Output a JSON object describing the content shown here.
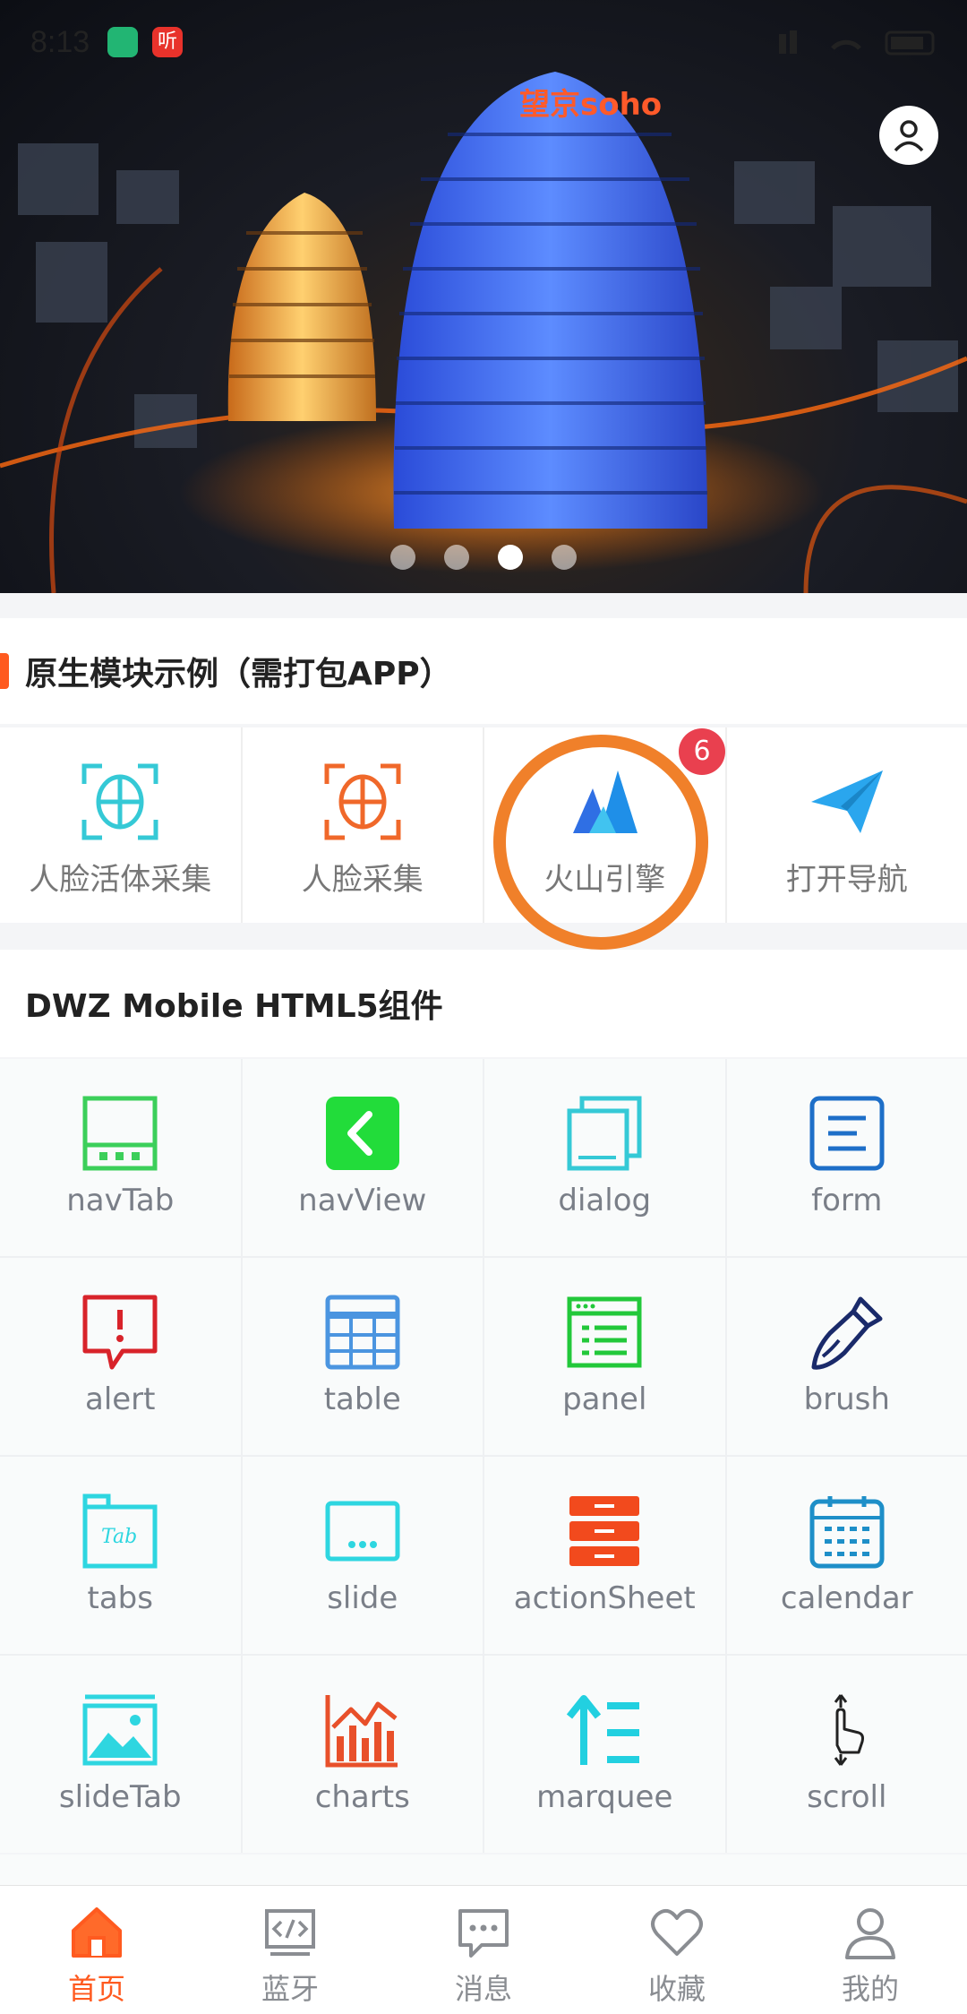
{
  "status_bar": {
    "time": "8:13",
    "app2_text": "听"
  },
  "banner": {
    "sign_text": "望京soho",
    "dots": 4,
    "active_dot": 2
  },
  "native_section": {
    "title": "原生模块示例（需打包APP）",
    "items": [
      {
        "label": "人脸活体采集",
        "icon": "face-scan-icon",
        "color": "#35c9d6"
      },
      {
        "label": "人脸采集",
        "icon": "face-capture-icon",
        "color": "#f0682a"
      },
      {
        "label": "火山引擎",
        "icon": "volcano-engine-icon",
        "color": "#2f6fe4",
        "badge": "6"
      },
      {
        "label": "打开导航",
        "icon": "paper-plane-icon",
        "color": "#2aa6ee"
      }
    ]
  },
  "components_section": {
    "title": "DWZ Mobile HTML5组件",
    "items": [
      {
        "label": "navTab",
        "icon": "nav-tab-icon"
      },
      {
        "label": "navView",
        "icon": "nav-view-icon"
      },
      {
        "label": "dialog",
        "icon": "dialog-icon"
      },
      {
        "label": "form",
        "icon": "form-icon"
      },
      {
        "label": "alert",
        "icon": "alert-icon"
      },
      {
        "label": "table",
        "icon": "table-icon"
      },
      {
        "label": "panel",
        "icon": "panel-icon"
      },
      {
        "label": "brush",
        "icon": "brush-icon"
      },
      {
        "label": "tabs",
        "icon": "tabs-icon"
      },
      {
        "label": "slide",
        "icon": "slide-icon"
      },
      {
        "label": "actionSheet",
        "icon": "action-sheet-icon"
      },
      {
        "label": "calendar",
        "icon": "calendar-icon"
      },
      {
        "label": "slideTab",
        "icon": "slide-tab-icon"
      },
      {
        "label": "charts",
        "icon": "charts-icon"
      },
      {
        "label": "marquee",
        "icon": "marquee-icon"
      },
      {
        "label": "scroll",
        "icon": "scroll-icon"
      }
    ]
  },
  "tabbar": {
    "items": [
      {
        "label": "首页",
        "icon": "home-icon",
        "active": true
      },
      {
        "label": "蓝牙",
        "icon": "code-icon",
        "active": false
      },
      {
        "label": "消息",
        "icon": "message-icon",
        "active": false
      },
      {
        "label": "收藏",
        "icon": "heart-icon",
        "active": false
      },
      {
        "label": "我的",
        "icon": "user-icon",
        "active": false
      }
    ],
    "active_color": "#ff5a1f"
  }
}
